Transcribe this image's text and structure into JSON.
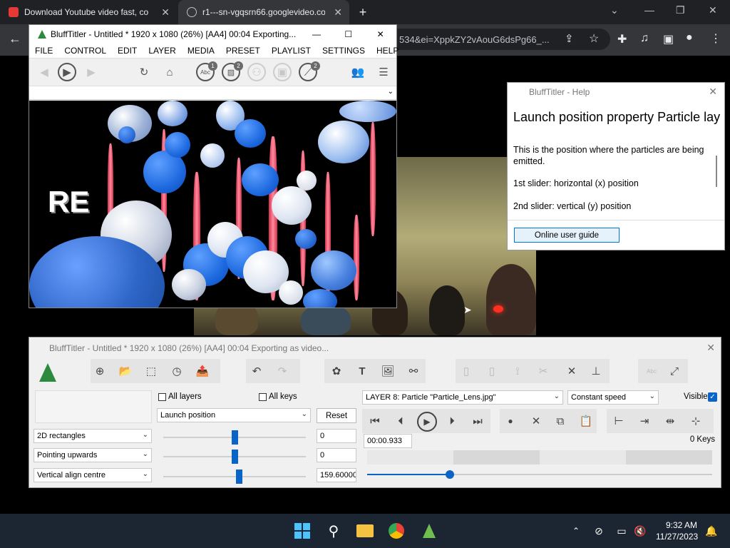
{
  "chrome": {
    "tabs": [
      {
        "title": "Download Youtube video fast, co",
        "favicon_color": "#e53935"
      },
      {
        "title": "r1---sn-vgqsrn66.googlevideo.co",
        "favicon_color": "#bdc1c6"
      }
    ],
    "new_tab": "+",
    "url_fragment": "534&ei=XppkZY2vAouG6dsPg66_...",
    "icons": [
      "back-arrow-icon",
      "share-icon",
      "star-icon",
      "extensions-icon",
      "media-icon",
      "sidepanel-icon",
      "profile-icon",
      "menu-icon"
    ]
  },
  "bt_top": {
    "title": "BluffTitler - Untitled * 1920 x 1080 (26%) [AA4] 00:04 Exporting...",
    "menu": [
      "FILE",
      "CONTROL",
      "EDIT",
      "LAYER",
      "MEDIA",
      "PRESET",
      "PLAYLIST",
      "SETTINGS",
      "HELP"
    ],
    "badges": {
      "abc": "1",
      "media": "2",
      "effect": "2"
    },
    "preview_text": "RE"
  },
  "help": {
    "window_title": "BluffTitler - Help",
    "heading": "Launch position property Particle lay",
    "body": [
      "This is the position where the particles are being emitted.",
      "1st slider: horizontal (x) position",
      "2nd slider: vertical (y) position"
    ],
    "button": "Online user guide"
  },
  "bt_bottom": {
    "title": "BluffTitler - Untitled * 1920 x 1080 (26%) [AA4] 00:04 Exporting as video...",
    "all_layers": "All layers",
    "all_keys": "All keys",
    "property": "Launch position",
    "reset": "Reset",
    "styles": [
      "2D rectangles",
      "Pointing upwards",
      "Vertical align centre"
    ],
    "slider_values": [
      "0",
      "0",
      "159.60000"
    ],
    "slider_levels": [
      0.5,
      0.5,
      0.53
    ],
    "layer": "LAYER 8: Particle \"Particle_Lens.jpg\"",
    "speed": "Constant speed",
    "visible": "Visible",
    "time": "00:00.933",
    "keys": "0 Keys",
    "timeline_level": 0.24
  },
  "taskbar": {
    "time": "9:32 AM",
    "date": "11/27/2023"
  }
}
